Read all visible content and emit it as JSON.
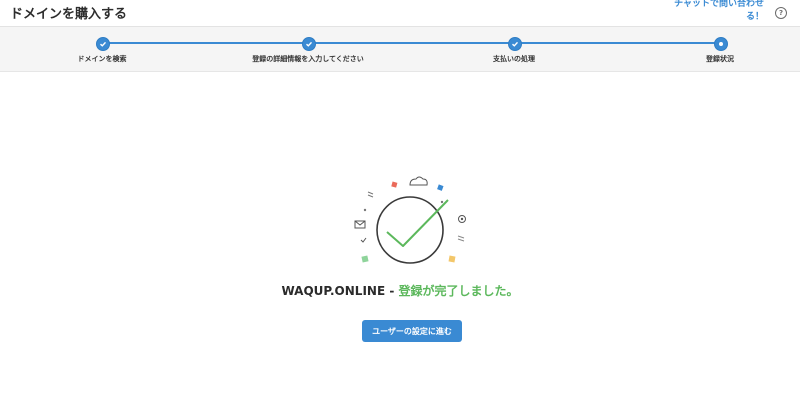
{
  "header": {
    "title": "ドメインを購入する",
    "chat_link": "チャットで問い合わせる！",
    "help_icon": "question-circle-icon"
  },
  "stepper": {
    "steps": [
      {
        "label": "ドメインを検索",
        "state": "done"
      },
      {
        "label": "登録の詳細情報を入力してください",
        "state": "done"
      },
      {
        "label": "支払いの処理",
        "state": "done"
      },
      {
        "label": "登録状況",
        "state": "current"
      }
    ],
    "accent": "#3a8ad3"
  },
  "result": {
    "domain": "WAQUP.ONLINE",
    "separator": " - ",
    "message": "登録が完了しました。",
    "success_color": "#5cb85c"
  },
  "cta": {
    "label": "ユーザーの設定に進む"
  }
}
